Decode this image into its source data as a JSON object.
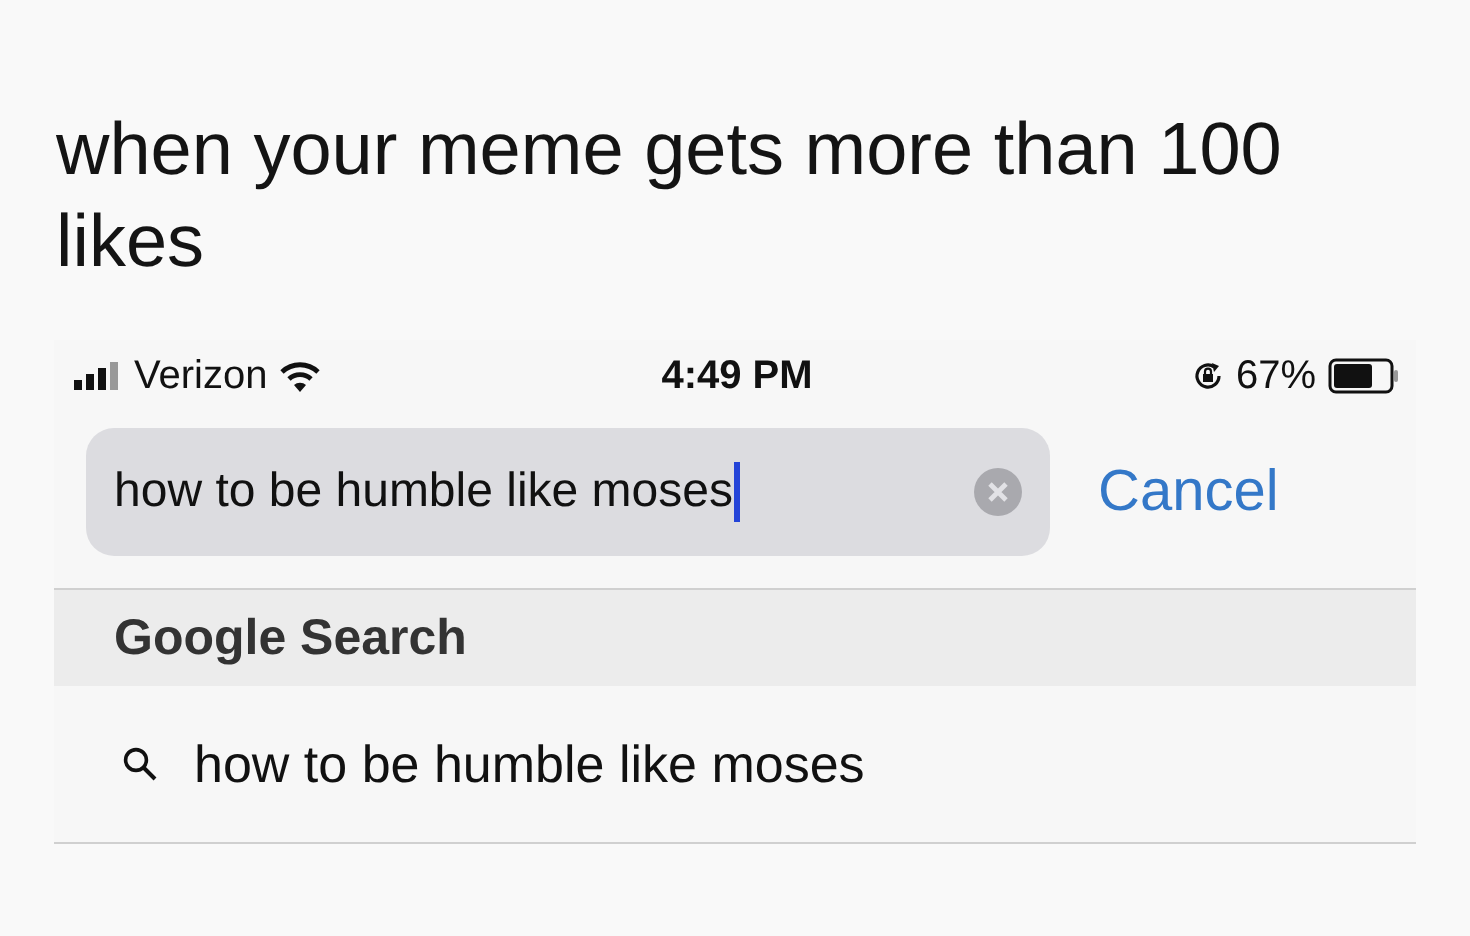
{
  "caption": "when your meme gets more than 100 likes",
  "status_bar": {
    "carrier": "Verizon",
    "time": "4:49 PM",
    "battery": "67%"
  },
  "search": {
    "value": "how to be humble like moses",
    "cancel": "Cancel"
  },
  "section_header": "Google Search",
  "suggestions": [
    {
      "text": "how to be humble like moses"
    }
  ]
}
